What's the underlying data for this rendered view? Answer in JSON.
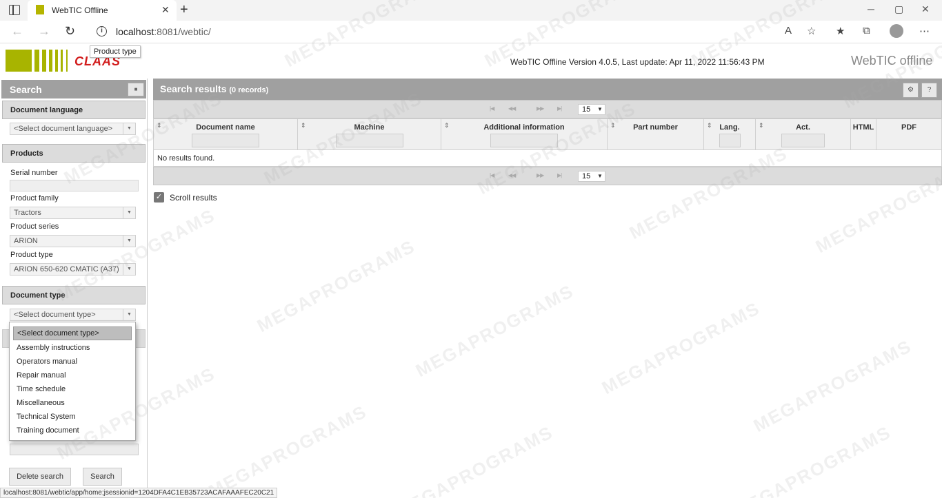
{
  "browser": {
    "tab_title": "WebTIC Offline",
    "url_host": "localhost",
    "url_rest": ":8081/webtic/",
    "status_url": "localhost:8081/webtic/app/home;jsessionid=1204DFA4C1EB35723ACAFAAAFEC20C21"
  },
  "header": {
    "logo_text": "CLAAS",
    "tooltip": "Product type",
    "version": "WebTIC Offline Version 4.0.5, Last update: Apr 11, 2022 11:56:43 PM",
    "brand": "WebTIC offline"
  },
  "search_panel": {
    "title": "Search",
    "collapse_icon": "collapse-icon",
    "doc_language": {
      "heading": "Document language",
      "value": "<Select document language>"
    },
    "products": {
      "heading": "Products",
      "serial_label": "Serial number",
      "serial_value": "",
      "family_label": "Product family",
      "family_value": "Tractors",
      "series_label": "Product series",
      "series_value": "ARION",
      "type_label": "Product type",
      "type_value": "ARION 650-620 CMATIC (A37)"
    },
    "doc_type": {
      "heading": "Document type",
      "value": "<Select document type>",
      "options": [
        "<Select document type>",
        "Assembly instructions",
        "Operators manual",
        "Repair manual",
        "Time schedule",
        "Miscellaneous",
        "Technical System",
        "Training document"
      ]
    },
    "delete_label": "Delete search",
    "search_label": "Search"
  },
  "results": {
    "title": "Search results",
    "count": "(0 records)",
    "page_size": "15",
    "columns": [
      "Document name",
      "Machine",
      "Additional information",
      "Part number",
      "Lang.",
      "Act.",
      "HTML",
      "PDF"
    ],
    "empty_text": "No results found.",
    "scroll_label": "Scroll results"
  },
  "watermark": "MEGAPROGRAMS",
  "colors": {
    "header_grey": "#a0a0a0",
    "logo_green": "#a8b400",
    "logo_red": "#d21c1c"
  }
}
